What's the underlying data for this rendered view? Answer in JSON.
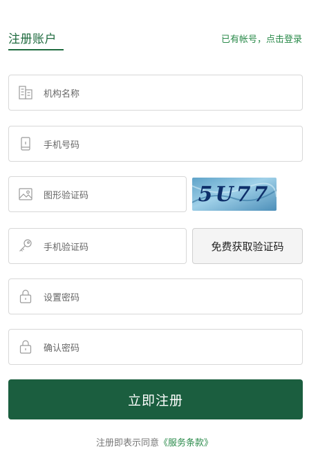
{
  "header": {
    "title": "注册账户",
    "login_link": "已有帐号，点击登录"
  },
  "fields": {
    "org_name": {
      "placeholder": "机构名称",
      "icon": "building-icon"
    },
    "phone": {
      "placeholder": "手机号码",
      "icon": "phone-icon"
    },
    "captcha": {
      "placeholder": "图形验证码",
      "icon": "image-icon",
      "image_text": "5U77"
    },
    "sms_code": {
      "placeholder": "手机验证码",
      "icon": "key-icon",
      "button_label": "免费获取验证码"
    },
    "password": {
      "placeholder": "设置密码",
      "icon": "lock-icon"
    },
    "confirm_password": {
      "placeholder": "确认密码",
      "icon": "lock-icon"
    }
  },
  "submit_label": "立即注册",
  "agreement": {
    "prefix": "注册即表示同意",
    "terms": "《服务条款》"
  },
  "colors": {
    "brand": "#1b5e3f",
    "link": "#2a8a4a"
  }
}
